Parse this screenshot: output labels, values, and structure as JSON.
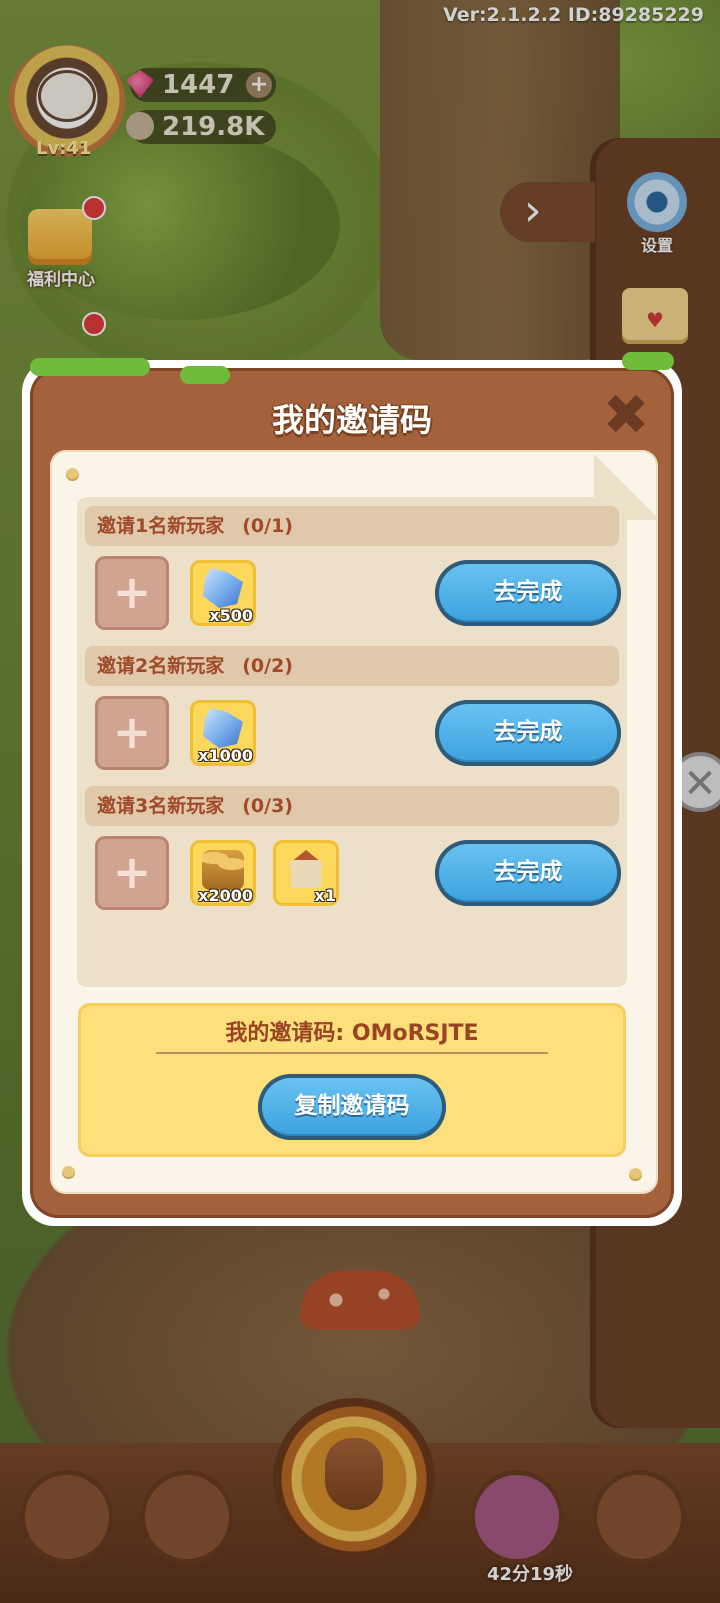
{
  "hud": {
    "version": "Ver:2.1.2.2 ID:89285229",
    "level": "Lv:41",
    "gems": "1447",
    "seeds": "219.8K",
    "welfare_label": "福利中心",
    "settings_label": "设置",
    "timer": "42分19秒"
  },
  "modal": {
    "title": "我的邀请码",
    "tasks": [
      {
        "title": "邀请1名新玩家",
        "progress": "(0/1)",
        "rewards": [
          {
            "icon": "crystal-icon",
            "qty": "x500"
          }
        ],
        "button": "去完成"
      },
      {
        "title": "邀请2名新玩家",
        "progress": "(0/2)",
        "rewards": [
          {
            "icon": "crystal-icon",
            "qty": "x1000"
          }
        ],
        "button": "去完成"
      },
      {
        "title": "邀请3名新玩家",
        "progress": "(0/3)",
        "rewards": [
          {
            "icon": "coins-icon",
            "qty": "x2000"
          },
          {
            "icon": "house-icon",
            "qty": "x1"
          }
        ],
        "button": "去完成"
      }
    ],
    "invite_code_line": "我的邀请码: OMoRSJTE",
    "copy_button": "复制邀请码"
  },
  "colors": {
    "button_blue": "#3a9fdd",
    "wood": "#a4623c",
    "paper": "#faf5e8"
  }
}
